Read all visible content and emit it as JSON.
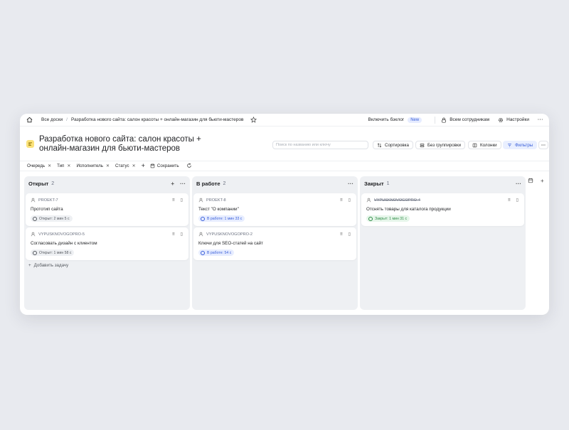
{
  "topbar": {
    "all_boards": "Все доски",
    "separator": "/",
    "current": "Разработка нового сайта: салон красоты + онлайн-магазин для бьюти-мастеров",
    "backlog_label": "Включить бэклог",
    "new_badge": "New",
    "share_label": "Всем сотрудникам",
    "settings_label": "Настройки",
    "more": "···"
  },
  "header": {
    "title": "Разработка нового сайта: салон красоты + онлайн-магазин для бьюти-мастеров",
    "search_placeholder": "Поиск по названию или ключу",
    "sort_label": "Сортировка",
    "group_label": "Без группировки",
    "columns_label": "Колонки",
    "filters_label": "Фильтры",
    "more": "···"
  },
  "filters": {
    "chips": [
      "Очередь",
      "Тип",
      "Исполнитель",
      "Статус"
    ],
    "plus": "+",
    "save_label": "Сохранить"
  },
  "columns": [
    {
      "title": "Открыт",
      "count": "2",
      "cards": [
        {
          "key": "PROEKT-7",
          "title": "Прототип сайта",
          "status": "Открыт: 2 мин 5 с"
        },
        {
          "key": "VYPUSKNOVOGOPRO-5",
          "title": "Согласовать дизайн с клиентом",
          "status": "Открыт: 1 мин 58 с"
        }
      ],
      "add_task": "Добавить задачу"
    },
    {
      "title": "В работе",
      "count": "2",
      "cards": [
        {
          "key": "PROEKT-8",
          "title": "Текст \"О компании\"",
          "status": "В работе: 1 мин 33 с"
        },
        {
          "key": "VYPUSKNOVOGOPRO-2",
          "title": "Ключи для SEO-статей на сайт",
          "status": "В работе: 54 с"
        }
      ]
    },
    {
      "title": "Закрыт",
      "count": "1",
      "cards": [
        {
          "key": "VYPUSKNOVOGOPRO-4",
          "title": "Отснять товары для каталога продукции",
          "status": "Закрыт: 1 мин 31 с"
        }
      ]
    }
  ],
  "colors": {
    "accent": "#3a5fd9",
    "board_icon": "#fbe27a",
    "closed": "#2e8b45"
  }
}
